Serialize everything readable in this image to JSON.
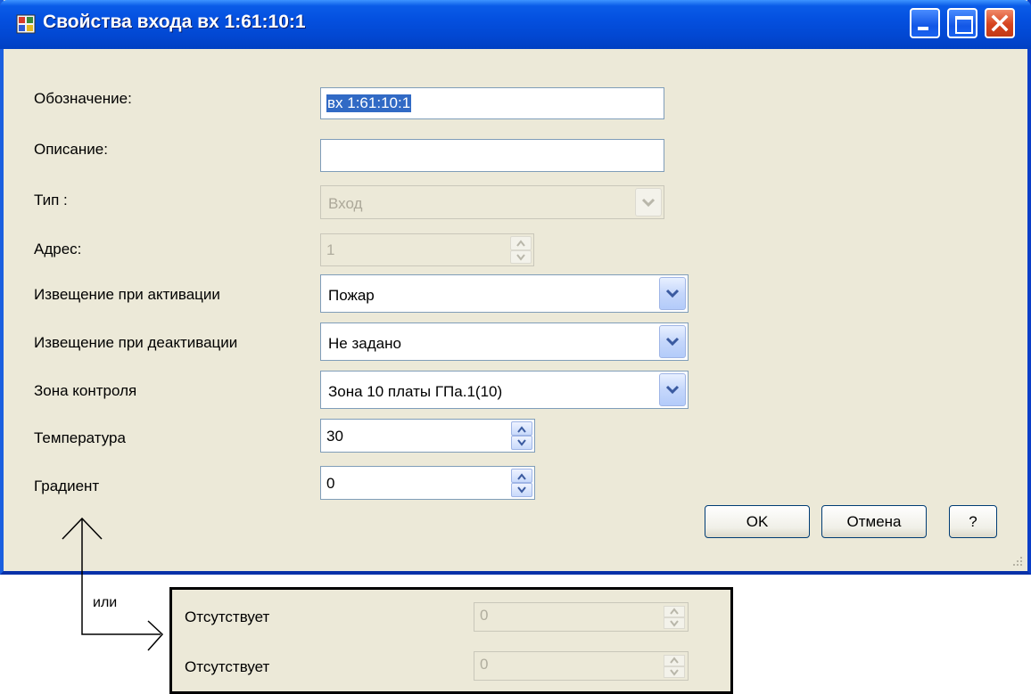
{
  "window": {
    "title": "Свойства входа вх 1:61:10:1",
    "icon": "app-window-icon",
    "controls": [
      "minimize-icon",
      "maximize-icon",
      "close-icon"
    ]
  },
  "form": {
    "designation": {
      "label": "Обозначение:",
      "value": "вх 1:61:10:1"
    },
    "description": {
      "label": "Описание:",
      "value": ""
    },
    "type": {
      "label": "Тип :",
      "value": "Вход"
    },
    "address": {
      "label": "Адрес:",
      "value": "1"
    },
    "alarm_on_activation": {
      "label": "Извещение при активации",
      "value": "Пожар"
    },
    "alarm_on_deactivation": {
      "label": "Извещение при деактивации",
      "value": "Не задано"
    },
    "control_zone": {
      "label": "Зона контроля",
      "value": "Зона 10 платы ГПа.1(10)"
    },
    "temperature": {
      "label": "Температура",
      "value": "30"
    },
    "gradient": {
      "label": "Градиент",
      "value": "0"
    }
  },
  "buttons": {
    "ok": "OK",
    "cancel": "Отмена",
    "help": "?"
  },
  "annotation": {
    "or_label": "или",
    "alternate_rows": [
      {
        "label": "Отсутствует",
        "value": "0"
      },
      {
        "label": "Отсутствует",
        "value": "0"
      }
    ]
  },
  "colors": {
    "titlebar": "#0450df",
    "frame": "#0a4fd6",
    "selection": "#316ac5",
    "dialog_bg": "#ece9d8"
  }
}
